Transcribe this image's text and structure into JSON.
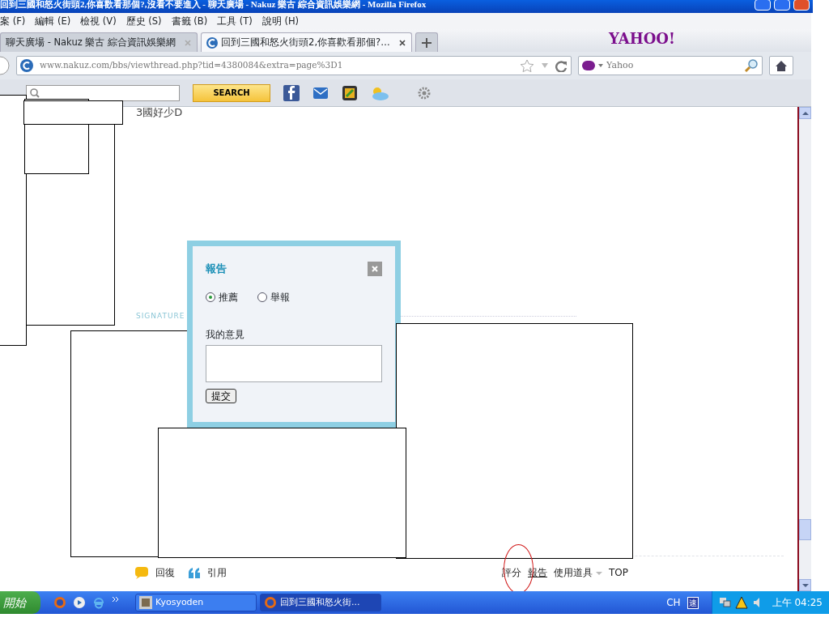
{
  "window": {
    "title": "回到三國和怒火街頭2,你喜歡看那個?,沒看不要進入 - 聊天廣場 - Nakuz 樂古 綜合資訊娛樂網 - Mozilla Firefox"
  },
  "menu": [
    "案 (F)",
    "編輯 (E)",
    "檢視 (V)",
    "歷史 (S)",
    "書籤 (B)",
    "工具 (T)",
    "說明 (H)"
  ],
  "tabs": [
    {
      "label": "聊天廣場 - Nakuz 樂古 綜合資訊娛樂網",
      "selected": false
    },
    {
      "label": "回到三國和怒火街頭2,你喜歡看那個?…",
      "selected": true
    }
  ],
  "brand": "YAHOO!",
  "address": "www.nakuz.com/bbs/viewthread.php?tid=4380084&extra=page%3D1",
  "search": {
    "placeholder": "Yahoo"
  },
  "toolbar": {
    "search_button": "SEARCH"
  },
  "post": {
    "text": "3國好少D",
    "signature_label": "SIGNATURE",
    "actions_left": [
      {
        "kind": "reply",
        "label": "回復"
      },
      {
        "kind": "quote",
        "label": "引用"
      }
    ],
    "actions_right": [
      {
        "label": "評分",
        "hovered": false,
        "caret": false
      },
      {
        "label": "報告",
        "hovered": true,
        "caret": false
      },
      {
        "label": "使用道具",
        "hovered": false,
        "caret": true
      },
      {
        "label": "TOP",
        "hovered": false,
        "caret": false
      }
    ]
  },
  "dialog": {
    "title": "報告",
    "options": [
      {
        "label": "推薦",
        "selected": true
      },
      {
        "label": "舉報",
        "selected": false
      }
    ],
    "comment_label": "我的意見",
    "submit": "提交"
  },
  "taskbar": {
    "start": "開始",
    "tasks": [
      {
        "label": "Kyosyoden",
        "selected": false
      },
      {
        "label": "回到三國和怒火街...",
        "selected": true
      }
    ],
    "language": "CH",
    "ime": "速",
    "clock": "上午 04:25"
  }
}
